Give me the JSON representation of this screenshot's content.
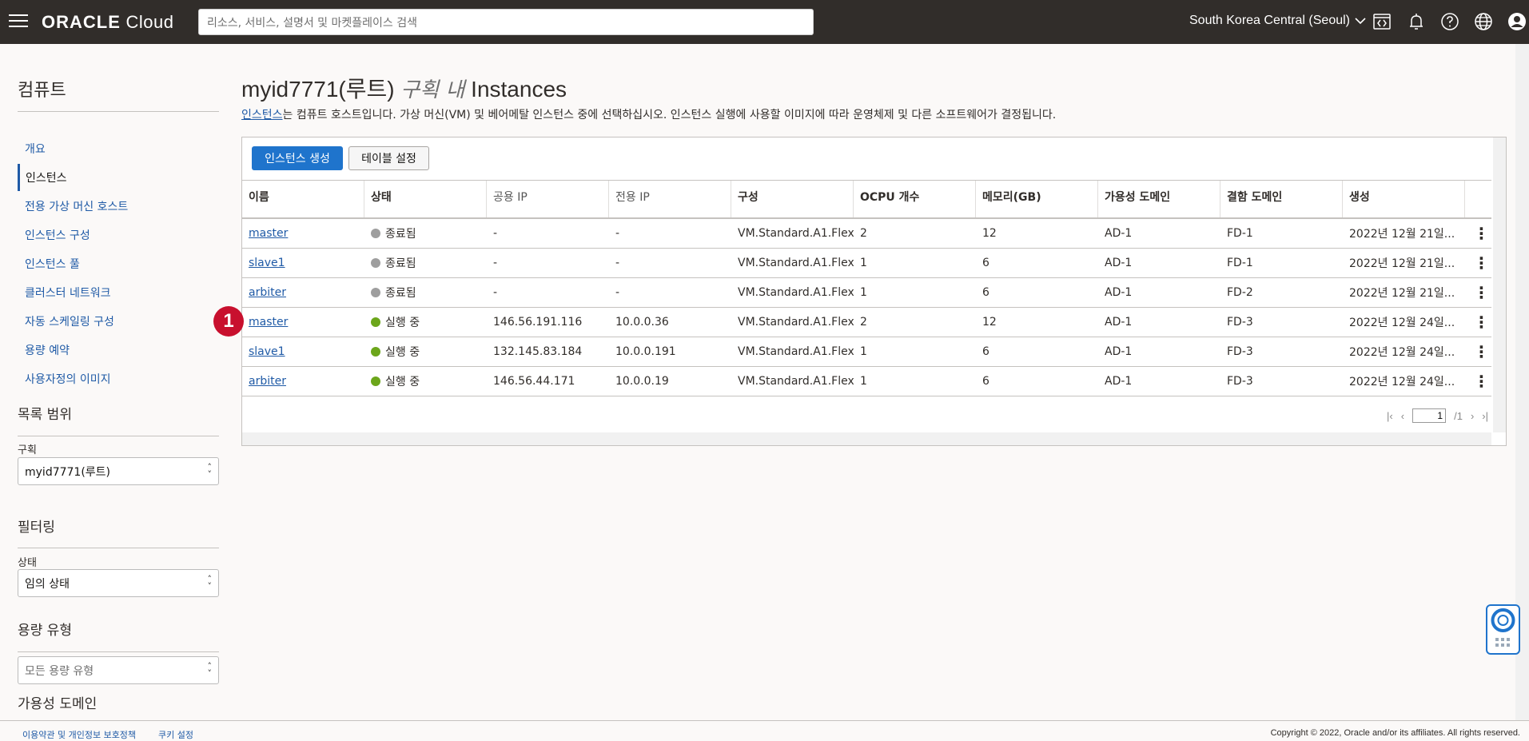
{
  "header": {
    "logo_brand": "ORACLE",
    "logo_product": "Cloud",
    "search_placeholder": "리소스, 서비스, 설명서 및 마켓플레이스 검색",
    "region": "South Korea Central (Seoul)",
    "icons": [
      "code-editor-icon",
      "bell-icon",
      "help-icon",
      "globe-icon",
      "user-icon"
    ]
  },
  "sidebar": {
    "title": "컴퓨트",
    "items": [
      {
        "label": "개요",
        "active": false
      },
      {
        "label": "인스턴스",
        "active": true
      },
      {
        "label": "전용 가상 머신 호스트",
        "active": false
      },
      {
        "label": "인스턴스 구성",
        "active": false
      },
      {
        "label": "인스턴스 풀",
        "active": false
      },
      {
        "label": "클러스터 네트워크",
        "active": false
      },
      {
        "label": "자동 스케일링 구성",
        "active": false
      },
      {
        "label": "용량 예약",
        "active": false
      },
      {
        "label": "사용자정의 이미지",
        "active": false
      }
    ],
    "list_scope": {
      "title": "목록 범위",
      "compartment_label": "구획",
      "compartment_value": "myid7771(루트)"
    },
    "filtering": {
      "title": "필터링",
      "state_label": "상태",
      "state_value": "임의 상태"
    },
    "capacity_type": {
      "title": "용량 유형",
      "placeholder": "모든 용량 유형"
    },
    "availability_domain_title": "가용성 도메인"
  },
  "main": {
    "title_prefix": "myid7771(루트)",
    "title_italic": "구획 내",
    "title_suffix": "Instances",
    "description_link": "인스턴스",
    "description_rest": "는 컴퓨트 호스트입니다. 가상 머신(VM) 및 베어메탈 인스턴스 중에 선택하십시오. 인스턴스 실행에 사용할 이미지에 따라 운영체제 및 다른 소프트웨어가 결정됩니다.",
    "create_button": "인스턴스 생성",
    "table_settings_button": "테이블 설정",
    "columns": [
      "이름",
      "상태",
      "공용 IP",
      "전용 IP",
      "구성",
      "OCPU 개수",
      "메모리(GB)",
      "가용성 도메인",
      "결함 도메인",
      "생성"
    ],
    "rows": [
      {
        "name": "master",
        "state": "종료됨",
        "state_color": "#9e9e9e",
        "public_ip": "-",
        "private_ip": "-",
        "shape": "VM.Standard.A1.Flex",
        "ocpu": "2",
        "memory": "12",
        "ad": "AD-1",
        "fd": "FD-1",
        "created": "2022년 12월 21일..."
      },
      {
        "name": "slave1",
        "state": "종료됨",
        "state_color": "#9e9e9e",
        "public_ip": "-",
        "private_ip": "-",
        "shape": "VM.Standard.A1.Flex",
        "ocpu": "1",
        "memory": "6",
        "ad": "AD-1",
        "fd": "FD-1",
        "created": "2022년 12월 21일..."
      },
      {
        "name": "arbiter",
        "state": "종료됨",
        "state_color": "#9e9e9e",
        "public_ip": "-",
        "private_ip": "-",
        "shape": "VM.Standard.A1.Flex",
        "ocpu": "1",
        "memory": "6",
        "ad": "AD-1",
        "fd": "FD-2",
        "created": "2022년 12월 21일..."
      },
      {
        "name": "master",
        "state": "실행 중",
        "state_color": "#6ca61b",
        "public_ip": "146.56.191.116",
        "private_ip": "10.0.0.36",
        "shape": "VM.Standard.A1.Flex",
        "ocpu": "2",
        "memory": "12",
        "ad": "AD-1",
        "fd": "FD-3",
        "created": "2022년 12월 24일..."
      },
      {
        "name": "slave1",
        "state": "실행 중",
        "state_color": "#6ca61b",
        "public_ip": "132.145.83.184",
        "private_ip": "10.0.0.191",
        "shape": "VM.Standard.A1.Flex",
        "ocpu": "1",
        "memory": "6",
        "ad": "AD-1",
        "fd": "FD-3",
        "created": "2022년 12월 24일..."
      },
      {
        "name": "arbiter",
        "state": "실행 중",
        "state_color": "#6ca61b",
        "public_ip": "146.56.44.171",
        "private_ip": "10.0.0.19",
        "shape": "VM.Standard.A1.Flex",
        "ocpu": "1",
        "memory": "6",
        "ad": "AD-1",
        "fd": "FD-3",
        "created": "2022년 12월 24일..."
      }
    ],
    "pagination": {
      "page": "1",
      "total": "/1"
    },
    "callout_number": "1"
  },
  "footer": {
    "terms": "이용약관 및 개인정보 보호정책",
    "cookies": "쿠키 설정",
    "copyright": "Copyright © 2022, Oracle and/or its affiliates. All rights reserved."
  },
  "colors": {
    "topbar": "#312d2a",
    "link": "#1f5aa6",
    "primary_button": "#1f74cc",
    "terminated": "#9e9e9e",
    "running": "#6ca61b",
    "callout": "#c8102e"
  }
}
